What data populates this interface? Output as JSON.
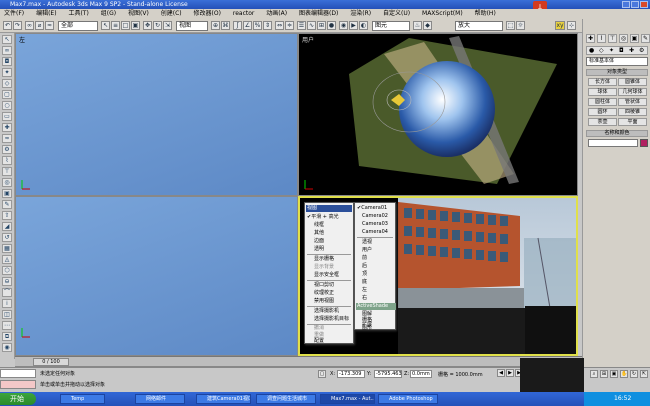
{
  "window": {
    "title": "Max7.max - Autodesk 3ds Max 9 SP2 - Stand-alone License"
  },
  "menubar": {
    "items": [
      "文件(F)",
      "编辑(E)",
      "工具(T)",
      "组(G)",
      "视图(V)",
      "创建(C)",
      "修改器(O)",
      "reactor",
      "动画(A)",
      "图表编辑器(D)",
      "渲染(R)",
      "自定义(U)",
      "MAXScript(M)",
      "帮助(H)"
    ]
  },
  "toolbar": {
    "select_filter": "全部",
    "view_select": "视图",
    "named_set": "",
    "render_type": "图元",
    "render_dropdown": "放大"
  },
  "viewports": {
    "top_left": {
      "label": "左"
    },
    "top_right": {
      "label": "用户"
    },
    "bottom_left": {
      "label": ""
    },
    "bottom_right": {
      "label": ""
    }
  },
  "context_menu": {
    "items": [
      "视图",
      "平滑 + 高光",
      "线框",
      "其他",
      "边面",
      "透明",
      "显示栅格",
      "显示背景",
      "显示安全框",
      "视口剪切",
      "纹理校正",
      "禁用视图",
      "选择摄影机",
      "选择摄影机目标",
      "撤消",
      "重做",
      "配置"
    ],
    "submenu": [
      "Camera01",
      "Camera02",
      "Camera03",
      "Camera04",
      "透视",
      "用户",
      "前",
      "后",
      "顶",
      "底",
      "左",
      "右",
      "ActiveShade",
      "图解",
      "栅格",
      "扩展",
      "图形"
    ]
  },
  "command_panel": {
    "object_type": "标准基本体",
    "section_title": "对象类型",
    "buttons": [
      "长方体",
      "圆锥体",
      "球体",
      "几何球体",
      "圆柱体",
      "管状体",
      "圆环",
      "四棱锥",
      "茶壶",
      "平面"
    ],
    "name_section": "名称和颜色"
  },
  "timeline": {
    "frame_label": "0 / 100"
  },
  "status": {
    "line1": "未选定任何对象",
    "line2": "单击或单击并拖动以选择对象",
    "x_label": "X:",
    "x_value": "-173.309",
    "y_label": "Y:",
    "y_value": "-5795.463",
    "z_label": "Z:",
    "z_value": "0.0mm",
    "grid": "栅格 = 1000.0mm"
  },
  "taskbar": {
    "start": "开始",
    "tasks": [
      "Temp",
      "网络邮件",
      "建筑Camera01视口 - 3",
      "调查问题生活城市",
      "Max7.max - Aut...",
      "Adobe Photoshop"
    ],
    "active_index": 4,
    "time": "16:52"
  }
}
